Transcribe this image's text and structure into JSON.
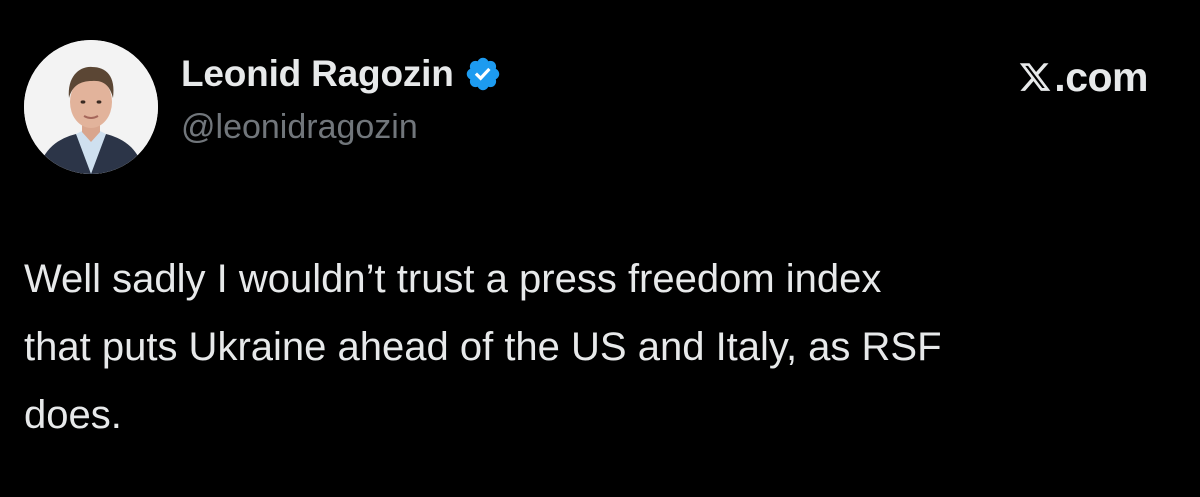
{
  "author": {
    "name": "Leonid Ragozin",
    "handle": "@leonidragozin",
    "verified_icon": "verified-badge-icon"
  },
  "source": {
    "domain": ".com",
    "icon": "x-logo-icon"
  },
  "tweet": {
    "text": "Well sadly I wouldn’t trust a press freedom index\nthat puts Ukraine ahead of the US and Italy, as RSF\ndoes."
  },
  "colors": {
    "background": "#000000",
    "text": "#e7e9ea",
    "handle": "#71767b",
    "verified": "#1d9bf0"
  }
}
